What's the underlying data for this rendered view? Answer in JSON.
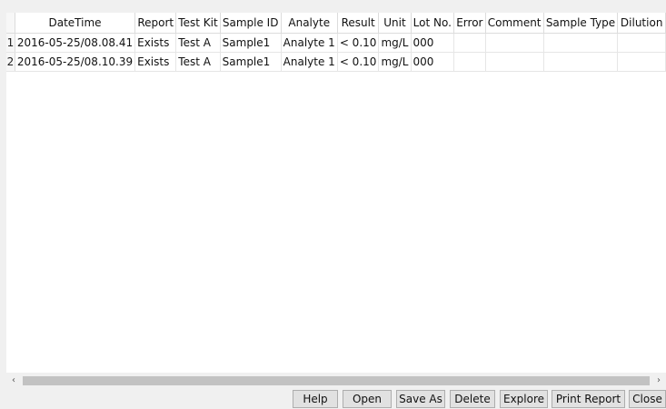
{
  "table": {
    "columns": [
      "",
      "DateTime",
      "Report",
      "Test Kit",
      "Sample ID",
      "Analyte",
      "Result",
      "Unit",
      "Lot No.",
      "Error",
      "Comment",
      "Sample Type",
      "Dilution"
    ],
    "rows": [
      [
        "1",
        "2016-05-25/08.08.41",
        "Exists",
        "Test A",
        "Sample1",
        "Analyte 1",
        "< 0.10",
        "mg/L",
        "000",
        "",
        "",
        "",
        ""
      ],
      [
        "2",
        "2016-05-25/08.10.39",
        "Exists",
        "Test A",
        "Sample1",
        "Analyte 1",
        "< 0.10",
        "mg/L",
        "000",
        "",
        "",
        "",
        ""
      ]
    ]
  },
  "scrollbar": {
    "left_icon": "‹",
    "right_icon": "›",
    "position": 0
  },
  "buttons": {
    "help": "Help",
    "open": "Open",
    "save_as": "Save As",
    "delete": "Delete",
    "explore": "Explore",
    "print_report": "Print Report",
    "close": "Close"
  }
}
